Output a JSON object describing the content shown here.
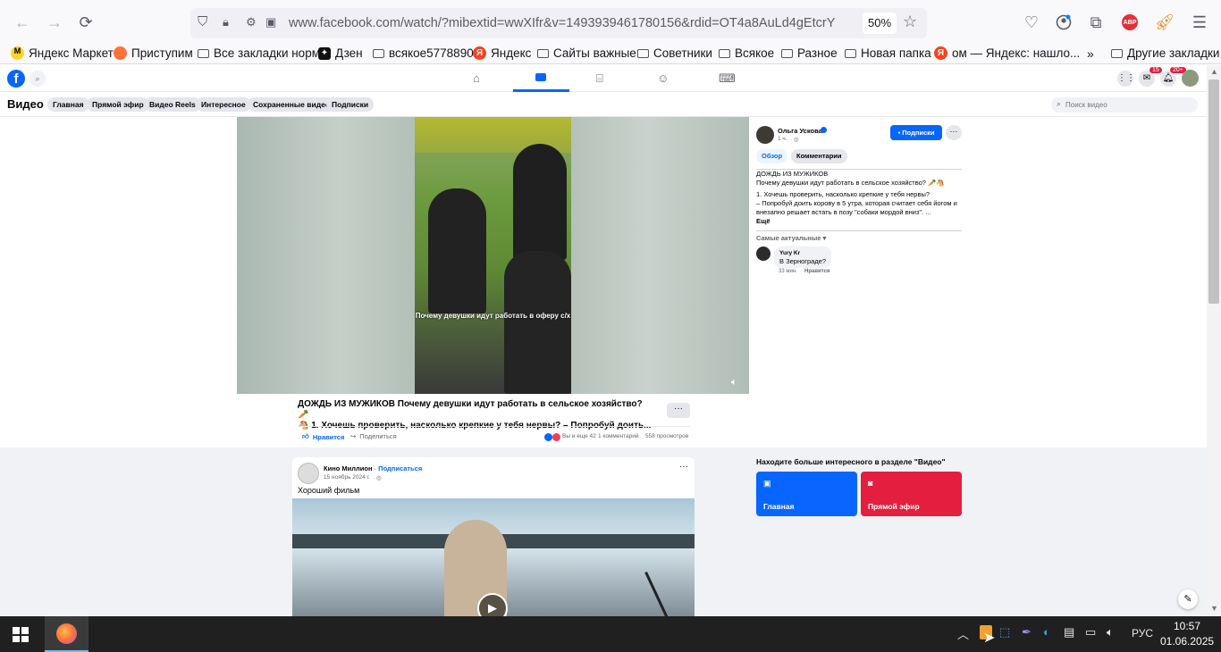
{
  "browser": {
    "url": "www.facebook.com/watch/?mibextid=wwXIfr&v=1493939461780156&rdid=OT4a8AuLd4gEtcrY",
    "zoom": "50%",
    "abp_label": "ABP"
  },
  "bookmarks": [
    {
      "label": "Яндекс Маркет",
      "icon": "yandex-market-icon"
    },
    {
      "label": "Приступим",
      "icon": "firefox-icon"
    },
    {
      "label": "Все закладки норм",
      "icon": "folder-icon"
    },
    {
      "label": "Дзен",
      "icon": "dzen-icon"
    },
    {
      "label": "всякое5778890",
      "icon": "folder-icon"
    },
    {
      "label": "Яндекс",
      "icon": "yandex-icon"
    },
    {
      "label": "Сайты важные",
      "icon": "folder-icon"
    },
    {
      "label": "Советники",
      "icon": "folder-icon"
    },
    {
      "label": "Всякое",
      "icon": "folder-icon"
    },
    {
      "label": "Разное",
      "icon": "folder-icon"
    },
    {
      "label": "Новая папка",
      "icon": "folder-icon"
    },
    {
      "label": "ом — Яндекс: нашло...",
      "icon": "yandex-icon"
    }
  ],
  "other_bookmarks": "Другие закладки",
  "fb": {
    "messenger_badge": "15",
    "notif_badge": "20+",
    "section_title": "Видео",
    "tabs": [
      "Главная",
      "Прямой эфир",
      "Видео Reels",
      "Интересное",
      "Сохраненные видео",
      "Подписки"
    ],
    "search_placeholder": "Поиск видео"
  },
  "video": {
    "overlay_text": "Почему девушки идут работать в оферу с/х",
    "title_line1": "ДОЖДЬ ИЗ МУЖИКОВ Почему девушки идут работать в сельское хозяйство? 🥕",
    "title_line2": "🐴 1. Хочешь проверить, насколько крепкие у тебя нервы? – Попробуй доить...",
    "like_label": "Нравится",
    "share_label": "Поделиться",
    "reactions": "Вы и еще 42",
    "comments": "1 комментарий",
    "views": "558 просмотров"
  },
  "side": {
    "author": "Ольга Ускова",
    "time": "1 ч.",
    "follow_label": "Подписки",
    "tab_overview": "Обзор",
    "tab_comments": "Комментарии",
    "desc_title": "ДОЖДЬ ИЗ МУЖИКОВ",
    "desc_line1": "Почему девушки идут работать в сельское хозяйство? 🥕🐴",
    "desc_line2": "1. Хочешь проверить, насколько крепкие у тебя нервы?",
    "desc_line3": "– Попробуй доить корову в 5 утра, которая считает себя йогом и",
    "desc_line4": "внезапно решает встать в позу \"собаки мордой вниз\". ...",
    "more": "Ещё",
    "sort": "Самые актуальные",
    "comment_author": "Yury Kr",
    "comment_text": "В Зернограде?",
    "comment_time": "33 мин.",
    "comment_like": "Нравится"
  },
  "post2": {
    "author": "Кино Миллион",
    "follow": "Подписаться",
    "date": "15 ноябрь 2024 г.",
    "text": "Хороший фильм"
  },
  "discover": {
    "title": "Находите больше интересного в разделе \"Видео\"",
    "home": "Главная",
    "live": "Прямой эфир"
  },
  "taskbar": {
    "lang": "РУС",
    "time": "10:57",
    "date": "01.06.2025"
  },
  "colors": {
    "fb_blue": "#0866ff",
    "live_red": "#e41e3f",
    "taskbar": "#202020"
  }
}
